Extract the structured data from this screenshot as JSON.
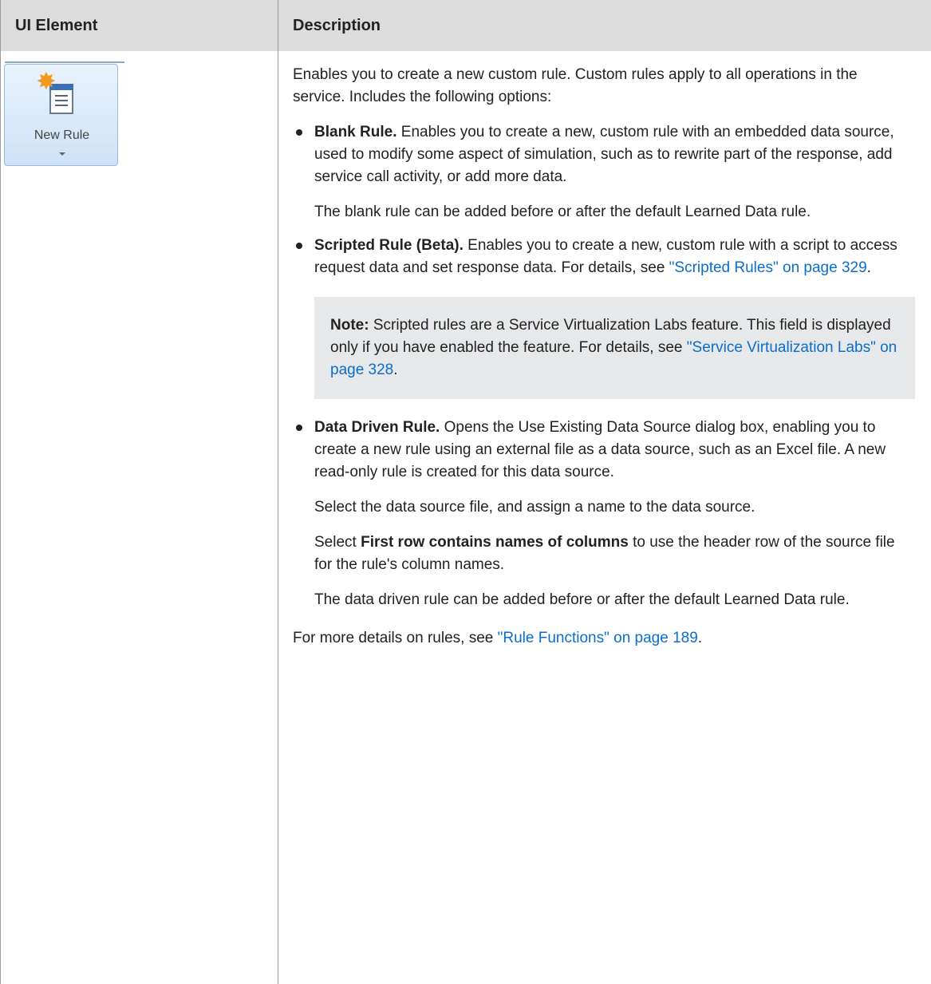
{
  "table": {
    "headers": {
      "element": "UI Element",
      "description": "Description"
    },
    "row": {
      "button": {
        "label": "New Rule",
        "icon": "new-rule-icon"
      },
      "intro": "Enables you to create a new custom rule. Custom rules apply to all operations in the service. Includes the following options:",
      "options": [
        {
          "title": "Blank Rule.",
          "text": "Enables you to create a new, custom rule with an embedded data source, used to modify some aspect of simulation, such as to rewrite part of the response, add service call activity, or add more data.",
          "extra": "The blank rule can be added before or after the default Learned Data rule."
        },
        {
          "title": "Scripted Rule (Beta).",
          "text": "Enables you to create a new, custom rule with a script to access request data and set response data. For details, see",
          "link": "\"Scripted Rules\" on page 329",
          "after_link": ".",
          "note": {
            "label": "Note:",
            "text": "Scripted rules are a Service Virtualization Labs feature. This field is displayed only if you have enabled the feature. For details, see",
            "link": "\"Service Virtualization Labs\" on page 328",
            "after_link": "."
          }
        },
        {
          "title": "Data Driven Rule.",
          "text": "Opens the Use Existing Data Source dialog box, enabling you to create a new rule using an external file as a data source, such as an Excel file. A new read-only rule is created for this data source.",
          "p2": "Select the data source file, and assign a name to the data source.",
          "p3_pre": "Select",
          "p3_bold": "First row contains names of columns",
          "p3_post": "to use the header row of the source file for the rule's column names.",
          "p4": "The data driven rule can be added before or after the default Learned Data rule."
        }
      ],
      "footer": {
        "text": "For more details on rules, see",
        "link": "\"Rule Functions\" on page 189",
        "after_link": "."
      }
    }
  },
  "colors": {
    "header_bg": "#dcdcdc",
    "link": "#0b6ecc",
    "note_bg": "#e6e8ea"
  }
}
